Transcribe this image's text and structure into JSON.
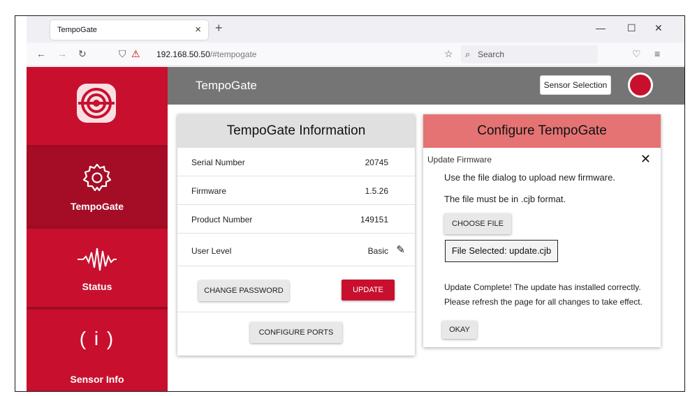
{
  "browser": {
    "tab_title": "TempoGate",
    "url_host": "192.168.50.50",
    "url_path": "/#tempogate",
    "search_placeholder": "Search"
  },
  "sidebar": {
    "items": [
      {
        "label": "",
        "icon": "logo-icon"
      },
      {
        "label": "TempoGate",
        "icon": "gear-icon",
        "active": true
      },
      {
        "label": "Status",
        "icon": "waveform-icon"
      },
      {
        "label": "Sensor Info",
        "icon": "info-icon"
      }
    ],
    "info_glyph": "( i )"
  },
  "topbar": {
    "title": "TempoGate",
    "sensor_button": "Sensor Selection",
    "status_color": "#c8102e"
  },
  "info_card": {
    "title": "TempoGate Information",
    "rows": [
      {
        "key": "Serial Number",
        "value": "20745"
      },
      {
        "key": "Firmware",
        "value": "1.5.26"
      },
      {
        "key": "Product Number",
        "value": "149151"
      },
      {
        "key": "User Level",
        "value": "Basic"
      }
    ],
    "change_password": "CHANGE PASSWORD",
    "update": "UPDATE",
    "configure_ports": "CONFIGURE PORTS"
  },
  "config_card": {
    "title": "Configure TempoGate",
    "section": "Update Firmware",
    "line1": "Use the file dialog to upload new firmware.",
    "line2": "The file must be in .cjb format.",
    "choose_file": "CHOOSE FILE",
    "file_selected": "File Selected: update.cjb",
    "complete1": "Update Complete! The update has installed correctly.",
    "complete2": "Please refresh the page for all changes to take effect.",
    "okay": "OKAY"
  },
  "colors": {
    "brand": "#c8102e",
    "topbar": "#757575",
    "config_header": "#e57373"
  }
}
